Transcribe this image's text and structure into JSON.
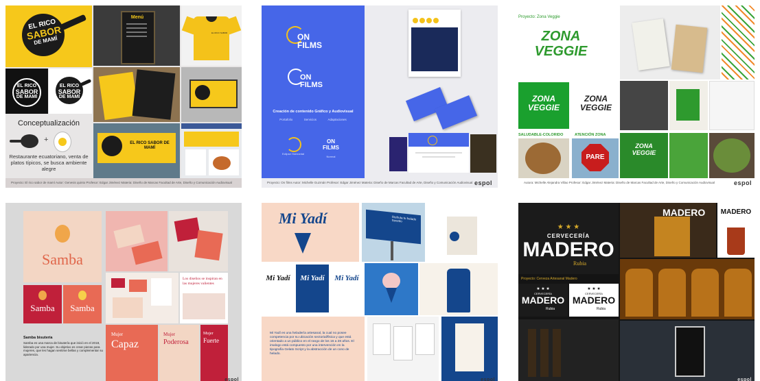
{
  "panel1": {
    "logo_line1": "EL RICO",
    "logo_line2": "SABOR",
    "logo_line3": "DE MAMÍ",
    "logo_small_line1": "EL RICO",
    "logo_small_line2": "SABOR",
    "logo_small_line3": "DE MAMÍ",
    "menu_title": "Menú",
    "tshirt_logo": "EL RICO SABOR",
    "sign_text": "EL RICO SABOR DE MAMÍ",
    "heading": "Conceptualización",
    "plus": "+",
    "description": "Restaurante ecuatoriano, venta de platos típicos, se busca ambiente alegre",
    "caption": "Proyecto: El rico sabor de mamí   Autor: Genesis quinto   Profesor: Edgar Jiménez   Materia: Diseño de Marcas          Facultad de Arte, Diseño y Comunicación Audiovisual"
  },
  "panel2": {
    "logo1": "ON FILMS",
    "logo2": "ON FILMS",
    "tagline": "Creación de contenido Gráfico y Audiovisual",
    "nav": [
      "Portafolio",
      "Servicios",
      "Adaptaciones"
    ],
    "logo3_label": "Eclipse Horizontal",
    "logo4": "ON FILMS",
    "logo4_label": "Normal",
    "caption": "Proyecto: On films  Autor: Michelle Guzmán  Profesor: Edgar Jiménez  Materia: Diseño de Marcas  Facultad de Arte, Diseño y Comunicación Audiovisual",
    "espol": "espol"
  },
  "panel3": {
    "project": "Proyecto: Zona Veggie",
    "logo_big": "ZONA VEGGIE",
    "logo_green": "ZONA VEGGIE",
    "logo_outline": "ZONA VEGGIE",
    "label_left": "SALUDABLE-COLORIDO",
    "label_right": "ATENCIÓN ZONA",
    "stop_sign": "PARE",
    "logo_card": "ZONA VEGGIE",
    "caption": "Autora: Michelle Alejandra Villao   Profesor: Edgar Jiménez   Materia: Diseño de Marcas   Facultad de Arte, Diseño y Comunicación Audiovisual",
    "espol": "espol"
  },
  "panel4": {
    "logo": "Samba",
    "logo_red": "Samba",
    "logo_coral": "Samba",
    "brand_title": "Samba bisutería",
    "brand_text": "Samba es una marca de bisutería que inició en el 2018, liderado por una mujer. Su objetivo es crear piezas para mujeres, que les hagan sentirse bellas y complementar su apariencia.",
    "poster1_small": "Mujer",
    "poster1_big": "Capaz",
    "poster2_small": "Mujer",
    "poster2_big": "Poderosa",
    "poster3_small": "Mujer",
    "poster3_big": "Fuerte",
    "quote": "Los diseños se inspiran en las mujeres valientes",
    "espol": "espol"
  },
  "panel5": {
    "logo": "Mi Yadí",
    "logo_b1": "Mi Yadí",
    "logo_b2": "Mi Yadí",
    "logo_b3": "Mi Yadí",
    "billboard": "Disfruta tu helado favorito",
    "description": "Mi Yadí es una heladería artesanal, la cual no posee competencia por su ubicación sectorial/fisica y que está orientado a un público en el rango de los 16 a 28 años. El imalogo está compuesto por una intervención en la tipografía Gelato Script y la abstracción de un cono de helado.",
    "espol": "espol"
  },
  "panel6": {
    "stars": "★ ★ ★",
    "brewery": "CERVECERÍA",
    "madero": "MADERO",
    "rubia": "Rubia",
    "project": "Proyecto: Cerveza Artesanal Madero",
    "stars_small": "★ ★ ★",
    "brewery_small": "CERVECERÍA",
    "madero_small": "MADERO",
    "rubia_small": "Rubia",
    "madero_white": "MADERO",
    "madero_top": "MADERO",
    "madero_label": "MADERO",
    "espol": "espol"
  }
}
